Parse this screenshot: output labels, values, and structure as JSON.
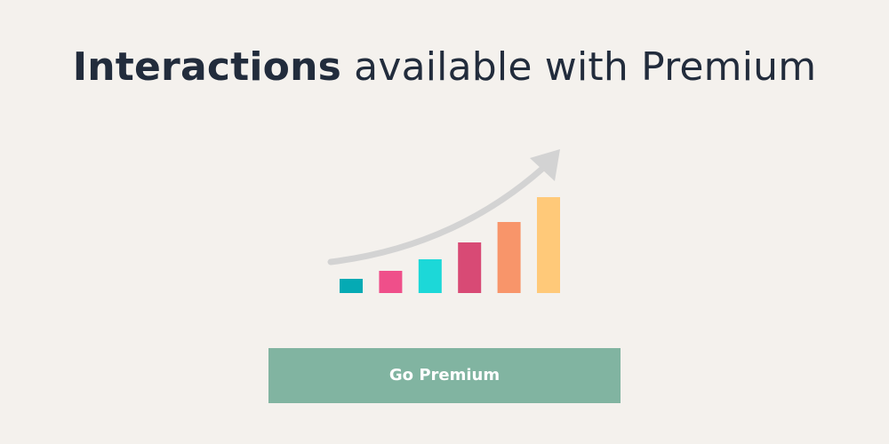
{
  "headline": {
    "bold_text": "Interactions",
    "rest_text": " available with Premium"
  },
  "illustration": {
    "icon": "growth-chart-icon",
    "arrow_color": "#d3d3d3",
    "bar_levels": [
      0.15,
      0.23,
      0.35,
      0.53,
      0.74,
      1.0
    ],
    "bar_colors": [
      "#05aab4",
      "#ef4f8a",
      "#1cd8d8",
      "#d84a75",
      "#f8956a",
      "#ffc979"
    ]
  },
  "cta": {
    "label": "Go Premium",
    "background": "#81b4a1"
  },
  "colors": {
    "background": "#f4f1ed",
    "text": "#222c3c"
  }
}
